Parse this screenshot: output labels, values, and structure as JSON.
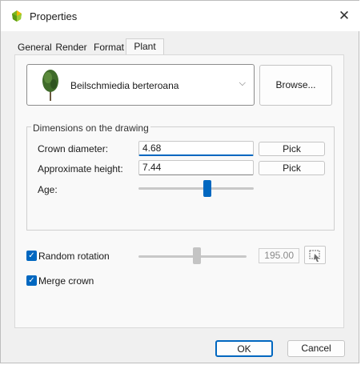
{
  "window": {
    "title": "Properties"
  },
  "tabs": [
    {
      "label": "General",
      "active": false
    },
    {
      "label": "Render",
      "active": false
    },
    {
      "label": "Format",
      "active": false
    },
    {
      "label": "Plant",
      "active": true
    }
  ],
  "plant": {
    "name": "Beilschmiedia berteroana",
    "browse_label": "Browse..."
  },
  "dimensions": {
    "group_label": "Dimensions on the drawing",
    "crown_diameter": {
      "label": "Crown diameter:",
      "value": "4.68",
      "pick_label": "Pick"
    },
    "approximate_height": {
      "label": "Approximate height:",
      "value": "7.44",
      "pick_label": "Pick"
    },
    "age": {
      "label": "Age:",
      "level": 0.6
    }
  },
  "random_rotation": {
    "label": "Random rotation",
    "checked": true,
    "value": "195.00",
    "level": 0.54
  },
  "merge_crown": {
    "label": "Merge crown",
    "checked": true
  },
  "footer": {
    "ok_label": "OK",
    "cancel_label": "Cancel"
  },
  "colors": {
    "accent": "#0067c0",
    "disabled_thumb": "#c4c4c4"
  },
  "icons": {
    "app": "plant-logo-icon",
    "close": "close-icon",
    "dropdown": "chevron-down-icon",
    "pick": "pick-point-icon",
    "check": "checkmark-icon"
  }
}
